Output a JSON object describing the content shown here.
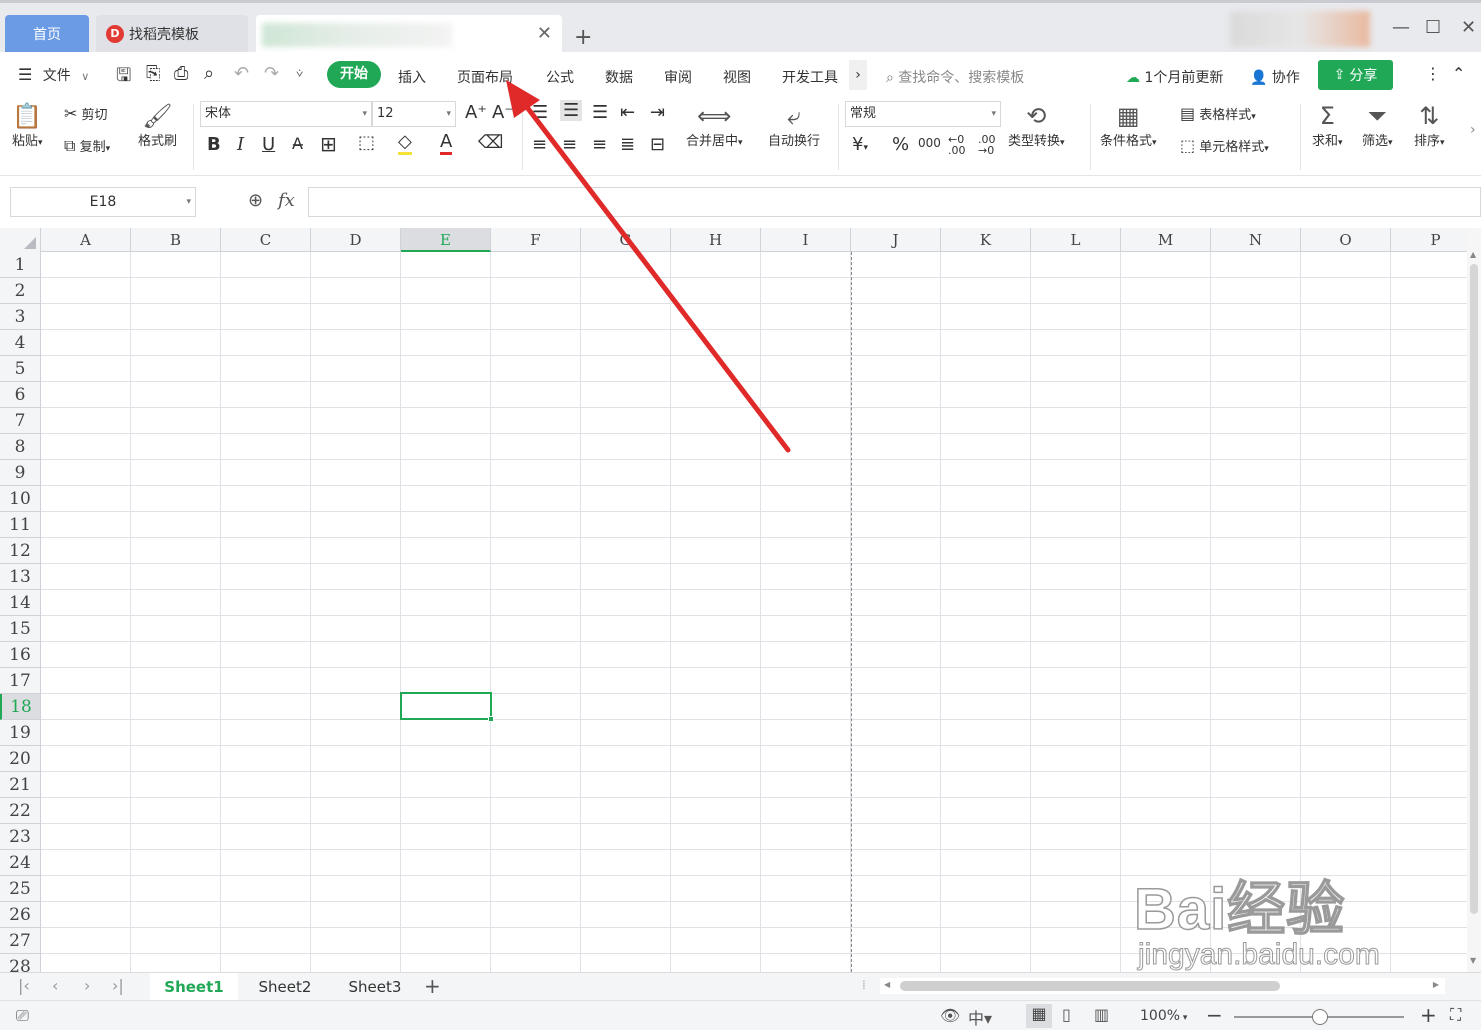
{
  "titlebar": {
    "tabs": [
      {
        "label": "首页"
      },
      {
        "label": "找稻壳模板"
      }
    ],
    "add_tab": "+",
    "window_controls": [
      "minimize-icon",
      "maximize-icon",
      "close-icon"
    ]
  },
  "menubar": {
    "file": "文件",
    "tabs": [
      "开始",
      "插入",
      "页面布局",
      "公式",
      "数据",
      "审阅",
      "视图",
      "开发工具"
    ],
    "active_tab": "开始",
    "search_placeholder": "查找命令、搜索模板",
    "update": "1个月前更新",
    "collab": "协作",
    "share": "分享"
  },
  "ribbon": {
    "paste": "粘贴",
    "cut": "剪切",
    "copy": "复制",
    "format_painter": "格式刷",
    "font_name": "宋体",
    "font_size": "12",
    "merge_center": "合并居中",
    "wrap_text": "自动换行",
    "number_format": "常规",
    "type_convert": "类型转换",
    "conditional_format": "条件格式",
    "table_style": "表格样式",
    "cell_style": "单元格样式",
    "sum": "求和",
    "filter": "筛选",
    "sort": "排序"
  },
  "formulabar": {
    "name_box": "E18",
    "fx": "fx",
    "value": ""
  },
  "grid": {
    "columns": [
      "A",
      "B",
      "C",
      "D",
      "E",
      "F",
      "G",
      "H",
      "I",
      "J",
      "K",
      "L",
      "M",
      "N",
      "O",
      "P"
    ],
    "rows": [
      "1",
      "2",
      "3",
      "4",
      "5",
      "6",
      "7",
      "8",
      "9",
      "10",
      "11",
      "12",
      "13",
      "14",
      "15",
      "16",
      "17",
      "18",
      "19",
      "20",
      "21",
      "22",
      "23",
      "24",
      "25",
      "26",
      "27",
      "28"
    ],
    "active_cell": "E18",
    "active_column": "E",
    "active_row": "18"
  },
  "sheets": [
    "Sheet1",
    "Sheet2",
    "Sheet3"
  ],
  "active_sheet": "Sheet1",
  "statusbar": {
    "zoom": "100%"
  },
  "watermark": {
    "line1": "Bai经验",
    "line2": "jingyan.baidu.com"
  },
  "colors": {
    "accent_green": "#20a857",
    "annotation_arrow": "#e02a2a",
    "home_tab": "#6b9be5"
  }
}
